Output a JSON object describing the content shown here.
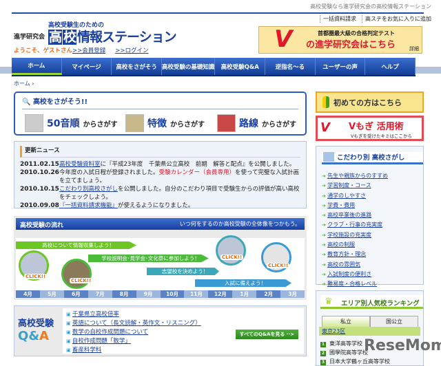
{
  "header": {
    "tagline": "高校受験なら進学研究会の高校情報ステーション",
    "util_links": [
      "一括資料請求",
      "高ステをお気に入りに追加"
    ],
    "logo_sub": "高校受験生のための",
    "logo_org": "進学研究会",
    "logo_boxed": [
      "高",
      "校"
    ],
    "logo_rest": "情報ステーション",
    "welcome": "ようこそ、ゲストさん",
    "register": ">>会員登録",
    "login": ">>ログイン"
  },
  "banner": {
    "v": "V",
    "line1": "首都圏最大級の合格判定テスト",
    "line2": "の進学研究会はこちら",
    "detail": "詳細"
  },
  "nav": [
    "ホーム",
    "マイページ",
    "高校をさがそう",
    "高校受験の基礎知識",
    "高校受験Q&A",
    "逆指名～る",
    "ユーザーの声",
    "ヘルプ"
  ],
  "breadcrumb": "ホーム ›",
  "search": {
    "title": "高校をさがそう!!",
    "items": [
      {
        "big": "50音順",
        "small": "からさがす"
      },
      {
        "big": "特徴",
        "small": "からさがす"
      },
      {
        "big": "路線",
        "small": "からさがす"
      }
    ]
  },
  "news": {
    "title": "更新ニュース",
    "items": [
      {
        "date": "2011.02.15",
        "link": "高校受験資料室",
        "text": "に『平成23年度　千葉県公立高校　前期　解答と配点』を公開しました。"
      },
      {
        "date": "2010.10.26",
        "pre": "今年度の入試日程が登録されました。",
        "red": "受験カレンダー（会員専用）",
        "text": "を使って完璧な入試計画を立てましょう。"
      },
      {
        "date": "2010.10.15",
        "link": "こだわり別高校さがし",
        "text": "を公開しました。自分のこだわり項目で受験生からの評価が高い高校をチェックしよう。"
      },
      {
        "date": "2010.09.08",
        "link": "『一括資料請求機能』",
        "text": "が使えるようになりました。"
      }
    ]
  },
  "flow": {
    "title": "高校受験の流れ",
    "subtitle": "いつ何をするのか高校受験の全体像をつかもう。",
    "steps": [
      "高校について情報収集しよう！",
      "学校説明会･見学会･文化祭に参加しよう！",
      "志望校を決めよう！",
      "入試に備えよう！"
    ],
    "click": "CLICK!!",
    "months": [
      "4月",
      "5月",
      "6月",
      "7月",
      "8月",
      "9月",
      "10月",
      "11月",
      "12月",
      "1月",
      "2月",
      "3月"
    ]
  },
  "qa": {
    "logo_top": "高校受験",
    "logo_q": "Q",
    "logo_amp": "&",
    "logo_a": "A",
    "items": [
      "千葉県立高校倍率",
      "英語について（長文読解・英作文・リスニング）",
      "数学の自校作成問題について",
      "自校作成問題「数学」",
      "畜産科学科"
    ],
    "all": "すべてのQ&Aを見る ··>"
  },
  "side": {
    "first": "初めての方はこちら",
    "vmogi_logo": "V",
    "vmogi_title": "Vもぎ 活用術",
    "vmogi_sub": "Vもぎを受けたキミはここから",
    "kodawari_title": "こだわり別 高校さがし",
    "kodawari": [
      "先生や親族からのすすめ",
      "学習制度・コース",
      "通学のしやすさ",
      "学費・費用",
      "高校卒業後の進路",
      "クラブ・行事の充実度",
      "学校施設の充実度",
      "高校の制服",
      "教育方針・理念",
      "高校の雰囲気",
      "入試制度の便利さ",
      "難易度・合格レベル"
    ],
    "ranking_title": "エリア別人気校ランキング",
    "tabs": [
      "私立",
      "国公立"
    ],
    "area": "東京23区",
    "schools": [
      {
        "n": "1",
        "name": "東洋高等学校"
      },
      {
        "n": "2",
        "name": "國學院高等学校"
      },
      {
        "n": "3",
        "name": "日本大学鶴ヶ丘高等学校"
      }
    ]
  },
  "watermark": "ReseMom"
}
